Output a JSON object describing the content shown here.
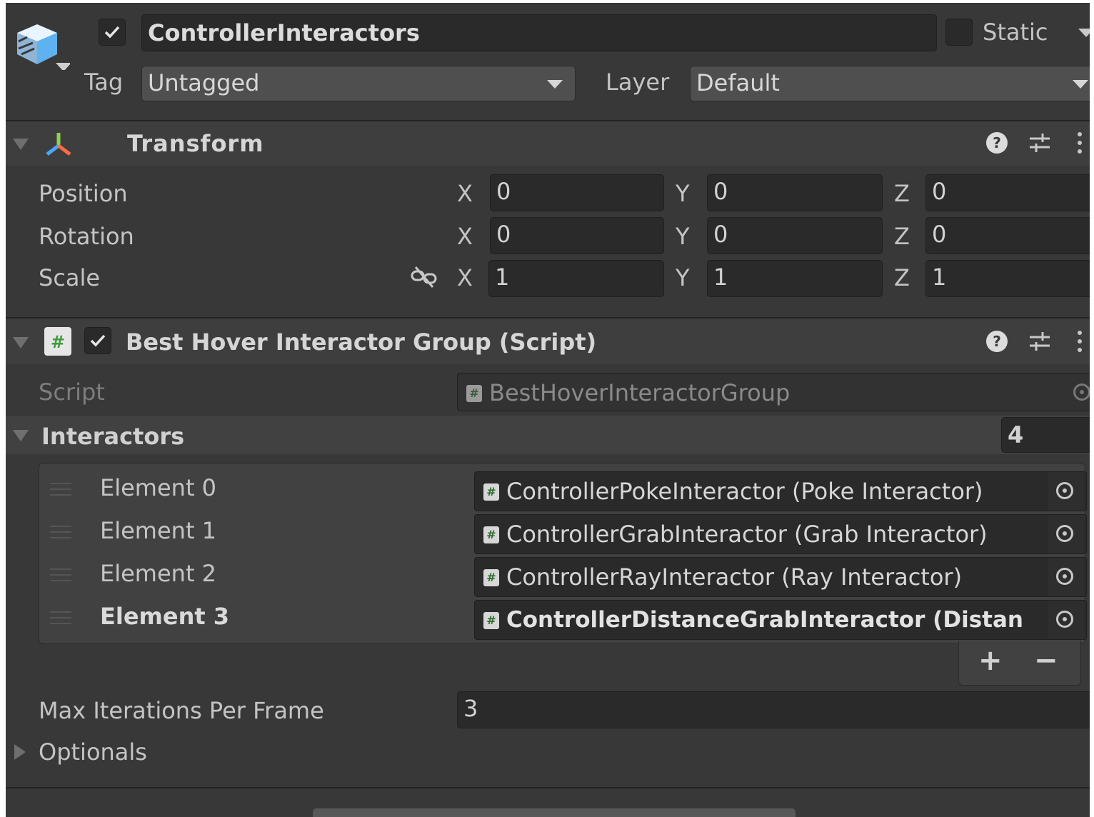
{
  "header": {
    "active": true,
    "name": "ControllerInteractors",
    "static_label": "Static",
    "tag_label": "Tag",
    "tag_value": "Untagged",
    "layer_label": "Layer",
    "layer_value": "Default"
  },
  "transform": {
    "title": "Transform",
    "rows": [
      {
        "label": "Position",
        "x": "0",
        "y": "0",
        "z": "0"
      },
      {
        "label": "Rotation",
        "x": "0",
        "y": "0",
        "z": "0"
      },
      {
        "label": "Scale",
        "x": "1",
        "y": "1",
        "z": "1"
      }
    ],
    "axis_x": "X",
    "axis_y": "Y",
    "axis_z": "Z"
  },
  "component": {
    "enabled": true,
    "title": "Best Hover Interactor Group (Script)",
    "script_label": "Script",
    "script_value": "BestHoverInteractorGroup",
    "interactors_label": "Interactors",
    "interactors_count": "4",
    "elements": [
      {
        "label": "Element 0",
        "value": "ControllerPokeInteractor (Poke Interactor)"
      },
      {
        "label": "Element 1",
        "value": "ControllerGrabInteractor (Grab Interactor)"
      },
      {
        "label": "Element 2",
        "value": "ControllerRayInteractor (Ray Interactor)"
      },
      {
        "label": "Element 3",
        "value": "ControllerDistanceGrabInteractor (Distan"
      }
    ],
    "add_label": "+",
    "remove_label": "−",
    "max_iter_label": "Max Iterations Per Frame",
    "max_iter_value": "3",
    "optionals_label": "Optionals"
  },
  "icons": {
    "gameobject": "cube-icon",
    "transform": "transform-axes-icon",
    "script": "script-hash-icon",
    "help": "help-icon",
    "presets": "presets-sliders-icon",
    "menu": "kebab-menu-icon",
    "constrain": "constrain-proportions-icon",
    "picker": "object-picker-icon"
  },
  "colors": {
    "panel": "#383838",
    "field": "#2a2a2a",
    "text": "#c4c4c4",
    "header_section": "#3e3e3e"
  }
}
